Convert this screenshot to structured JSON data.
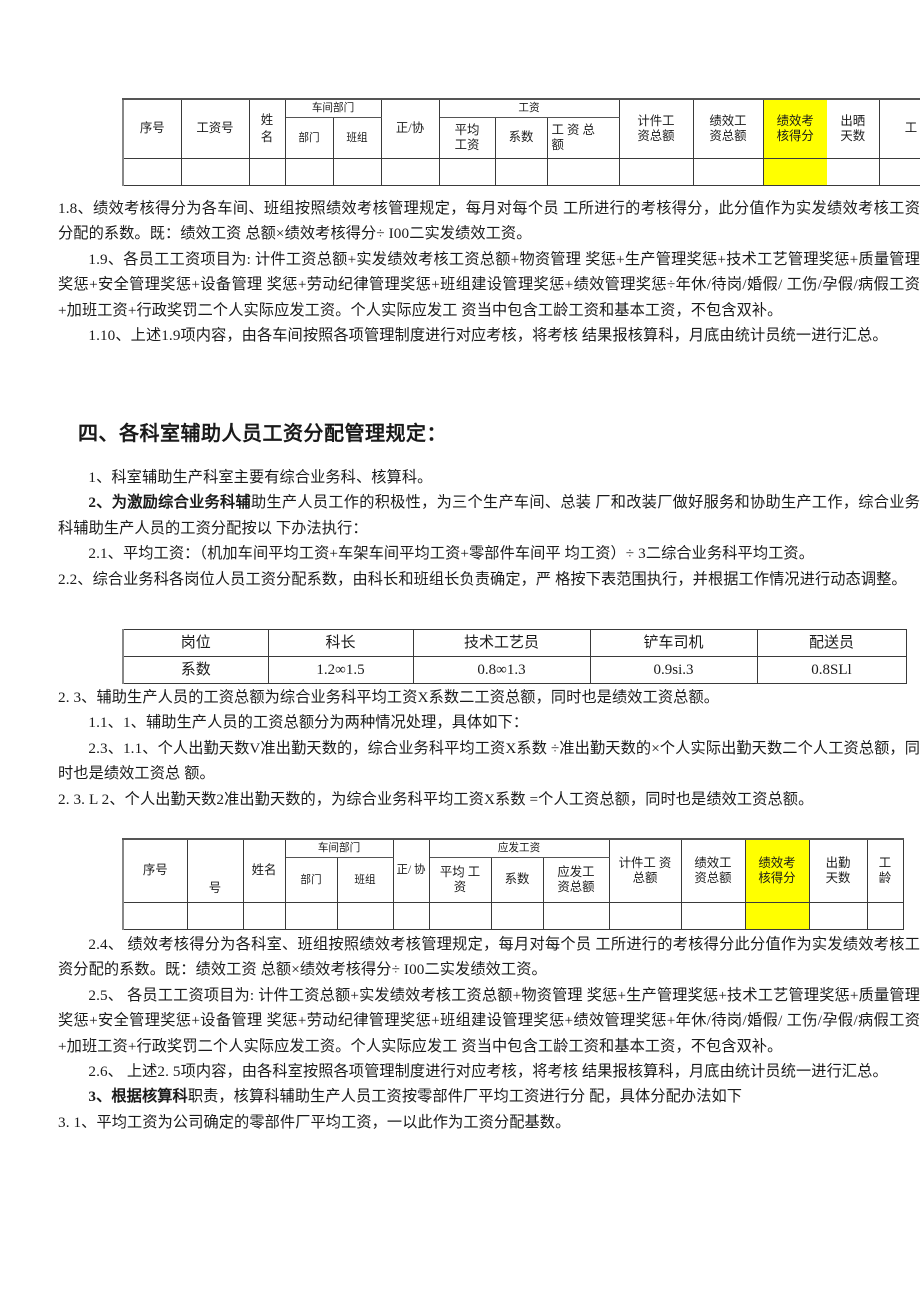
{
  "document": {
    "language": "zh-CN",
    "type": "salary-distribution-management-document"
  },
  "table1": {
    "name": "workshop-employee-salary-header-table",
    "headers": {
      "seq": "序号",
      "salary_no": "工资号",
      "name": "姓\n名",
      "workshop_dept_group": "车间部门",
      "dept": "部门",
      "team": "班组",
      "formal_assist": "正/协",
      "salary_group": "工资",
      "avg_salary": "平均\n工资",
      "coefficient": "系数",
      "salary_total": "工 资  总\n额",
      "piece_total": "计件工\n资总额",
      "perf_total": "绩效工\n资总额",
      "perf_score": "绩效考\n核得分",
      "attendance_days": "出晒\n天数",
      "seniority": "工"
    },
    "highlight_color": "#ffff00"
  },
  "table2": {
    "name": "position-coefficient-table",
    "rows": [
      [
        "岗位",
        "科长",
        "技术工艺员",
        "铲车司机",
        "配送员"
      ],
      [
        "系数",
        "1.2∞1.5",
        "0.8∞1.3",
        "0.9si.3",
        "0.8SLl"
      ]
    ]
  },
  "table3": {
    "name": "department-assistant-salary-header-table",
    "headers": {
      "seq": "序号",
      "salary_no": "号",
      "name": "姓名",
      "workshop_dept_group": "车间部门",
      "dept": "部门",
      "team": "班组",
      "formal_assist": "正/ 协",
      "payable_salary_group": "应发工资",
      "avg_salary": "平均 工\n资",
      "coefficient": "系数",
      "payable_total": "应发工\n资总额",
      "piece_total": "计件工 资\n总额",
      "perf_total": "绩效工\n资总额",
      "perf_score": "绩效考\n核得分",
      "attendance_days": "出勤\n天数",
      "seniority": "工\n龄"
    },
    "highlight_color": "#ffff00"
  },
  "paragraphs": {
    "p1_8": "1.8、绩效考核得分为各车间、班组按照绩效考核管理规定，每月对每个员 工所进行的考核得分，此分值作为实发绩效考核工资分配的系数。既：绩效工资 总额×绩效考核得分÷ I00二实发绩效工资。",
    "p1_9": "1.9、各员工工资项目为: 计件工资总额+实发绩效考核工资总额+物资管理 奖惩+生产管理奖惩+技术工艺管理奖惩+质量管理奖惩+安全管理奖惩+设备管理 奖惩+劳动纪律管理奖惩+班组建设管理奖惩+绩效管理奖惩÷年休/待岗/婚假/ 工伤/孕假/病假工资+加班工资+行政奖罚二个人实际应发工资。个人实际应发工 资当中包含工龄工资和基本工资，不包含双补。",
    "p1_10": "1.10、上述1.9项内容，由各车间按照各项管理制度进行对应考核，将考核 结果报核算科，月底由统计员统一进行汇总。",
    "heading4": "四、各科室辅助人员工资分配管理规定：",
    "p1": "1、科室辅助生产科室主要有综合业务科、核算科。",
    "p2_bold": "2、为激励综合业务科辅",
    "p2_rest": "助生产人员工作的积极性，为三个生产车间、总装 厂和改装厂做好服务和协助生产工作，综合业务科辅助生产人员的工资分配按以 下办法执行：",
    "p2_1": "2.1、平均工资：（机加车间平均工资+车架车间平均工资+零部件车间平 均工资）÷ 3二综合业务科平均工资。",
    "p2_2": "2.2、综合业务科各岗位人员工资分配系数，由科长和班组长负责确定，严 格按下表范围执行，并根据工作情况进行动态调整。",
    "p2_3": "2. 3、辅助生产人员的工资总额为综合业务科平均工资X系数二工资总额，同时也是绩效工资总额。",
    "p1_1": "1.1、1、辅助生产人员的工资总额分为两种情况处理，具体如下：",
    "p2_3_1_1": "2.3、1.1、个人出勤天数V准出勤天数的，综合业务科平均工资X系数 ÷准出勤天数的×个人实际出勤天数二个人工资总额，同时也是绩效工资总 额。",
    "p2_3_l_2": "2. 3. L 2、个人出勤天数2准出勤天数的，为综合业务科平均工资X系数 =个人工资总额，同时也是绩效工资总额。",
    "p2_4": "2.4、 绩效考核得分为各科室、班组按照绩效考核管理规定，每月对每个员 工所进行的考核得分此分值作为实发绩效考核工资分配的系数。既：绩效工资 总额×绩效考核得分÷ I00二实发绩效工资。",
    "p2_5": "2.5、 各员工工资项目为: 计件工资总额+实发绩效考核工资总额+物资管理 奖惩+生产管理奖惩+技术工艺管理奖惩+质量管理奖惩+安全管理奖惩+设备管理 奖惩+劳动纪律管理奖惩+班组建设管理奖惩+绩效管理奖惩+年休/待岗/婚假/ 工伤/孕假/病假工资+加班工资+行政奖罚二个人实际应发工资。个人实际应发工 资当中包含工龄工资和基本工资，不包含双补。",
    "p2_6": "2.6、 上述2. 5项内容，由各科室按照各项管理制度进行对应考核，将考核 结果报核算科，月底由统计员统一进行汇总。",
    "p3_bold": "3、根据核算科",
    "p3_rest": "职责，核算科辅助生产人员工资按零部件厂平均工资进行分 配，具体分配办法如下",
    "p3_1": "3. 1、平均工资为公司确定的零部件厂平均工资，一以此作为工资分配基数。"
  }
}
